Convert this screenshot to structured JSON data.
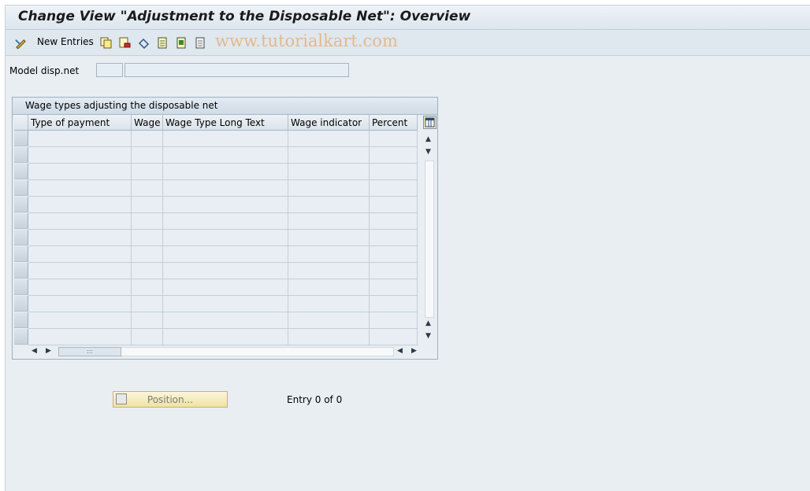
{
  "window": {
    "title": "Change View \"Adjustment to the Disposable Net\": Overview"
  },
  "toolbar": {
    "new_entries_label": "New Entries",
    "watermark": "www.tutorialkart.com",
    "icons": [
      "display-change-icon",
      "copy-icon",
      "delete-icon",
      "undo-change-icon",
      "select-all-icon",
      "select-block-icon",
      "deselect-all-icon"
    ]
  },
  "model": {
    "label": "Model disp.net",
    "code_value": "",
    "text_value": ""
  },
  "table": {
    "title": "Wage types adjusting the disposable net",
    "columns": [
      "Type of payment",
      "Wage",
      "Wage Type Long Text",
      "Wage indicator",
      "Percent"
    ],
    "rows": [
      [
        "",
        "",
        "",
        "",
        ""
      ],
      [
        "",
        "",
        "",
        "",
        ""
      ],
      [
        "",
        "",
        "",
        "",
        ""
      ],
      [
        "",
        "",
        "",
        "",
        ""
      ],
      [
        "",
        "",
        "",
        "",
        ""
      ],
      [
        "",
        "",
        "",
        "",
        ""
      ],
      [
        "",
        "",
        "",
        "",
        ""
      ],
      [
        "",
        "",
        "",
        "",
        ""
      ],
      [
        "",
        "",
        "",
        "",
        ""
      ],
      [
        "",
        "",
        "",
        "",
        ""
      ],
      [
        "",
        "",
        "",
        "",
        ""
      ],
      [
        "",
        "",
        "",
        "",
        ""
      ],
      [
        "",
        "",
        "",
        "",
        ""
      ]
    ]
  },
  "footer": {
    "position_button_label": "Position...",
    "entry_text": "Entry 0 of 0"
  }
}
